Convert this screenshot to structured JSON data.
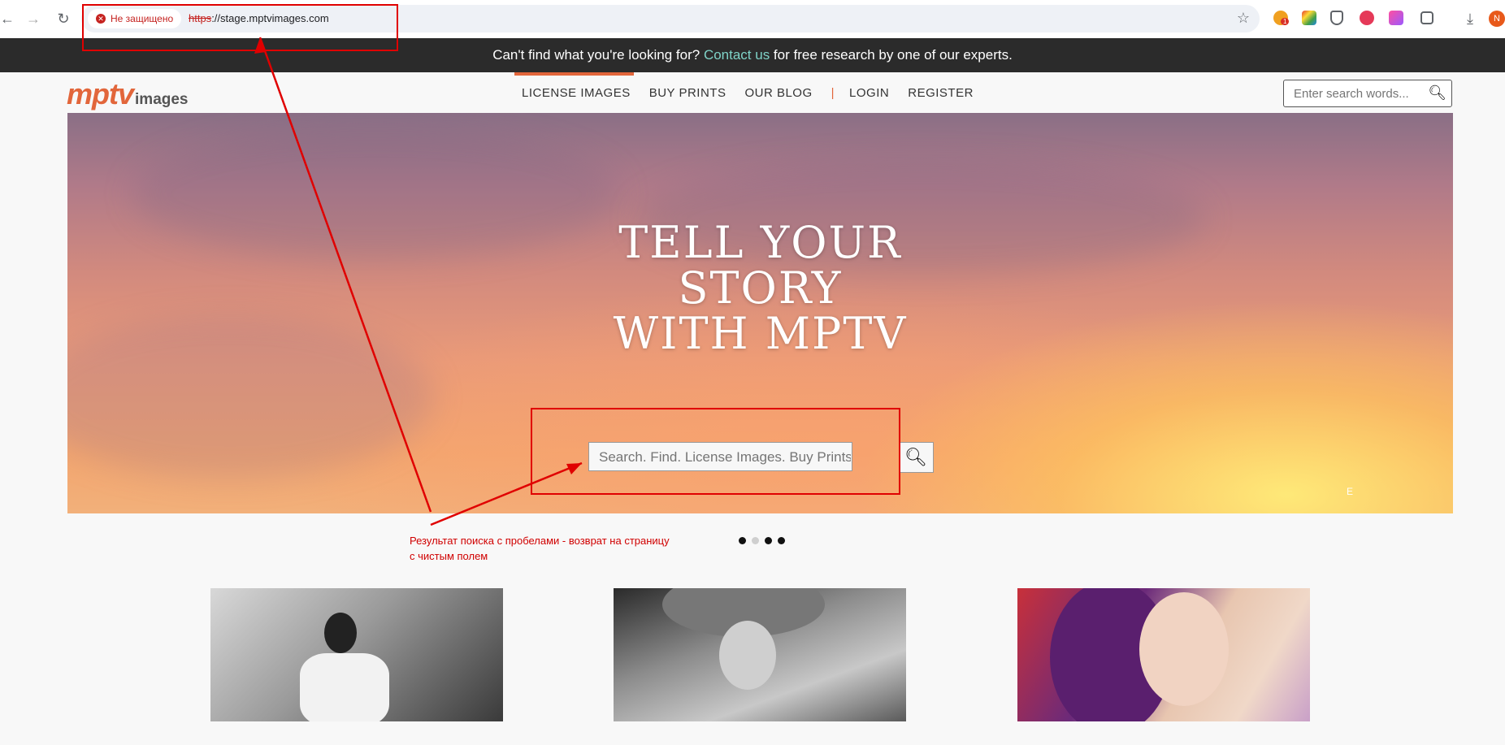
{
  "browser": {
    "security_label": "Не защищено",
    "url_scheme": "https",
    "url_rest": "://stage.mptvimages.com",
    "profile_initial": "N",
    "ext_badge": "1"
  },
  "banner": {
    "before": "Can't find what you're looking for? ",
    "link": "Contact us",
    "after": " for free research by one of our experts."
  },
  "header": {
    "logo_main": "mptv",
    "logo_sub": "images",
    "nav": [
      "LICENSE IMAGES",
      "BUY PRINTS",
      "OUR BLOG",
      "LOGIN",
      "REGISTER"
    ],
    "separator": "|",
    "search_placeholder": "Enter search words..."
  },
  "hero": {
    "title_lines": [
      "TELL YOUR",
      "STORY",
      "WITH MPTV"
    ],
    "search_placeholder": "Search. Find. License Images. Buy Prints.",
    "corner_mark": "E"
  },
  "carousel": {
    "dots": 4,
    "active_index": 1
  },
  "annotation": {
    "text_line1": "Результат поиска с пробелами - возврат на страницу",
    "text_line2": "с чистым полем",
    "color": "#e00000"
  },
  "colors": {
    "accent": "#e2663b",
    "banner_bg": "#2b2b2b",
    "link": "#7fd3c8"
  }
}
